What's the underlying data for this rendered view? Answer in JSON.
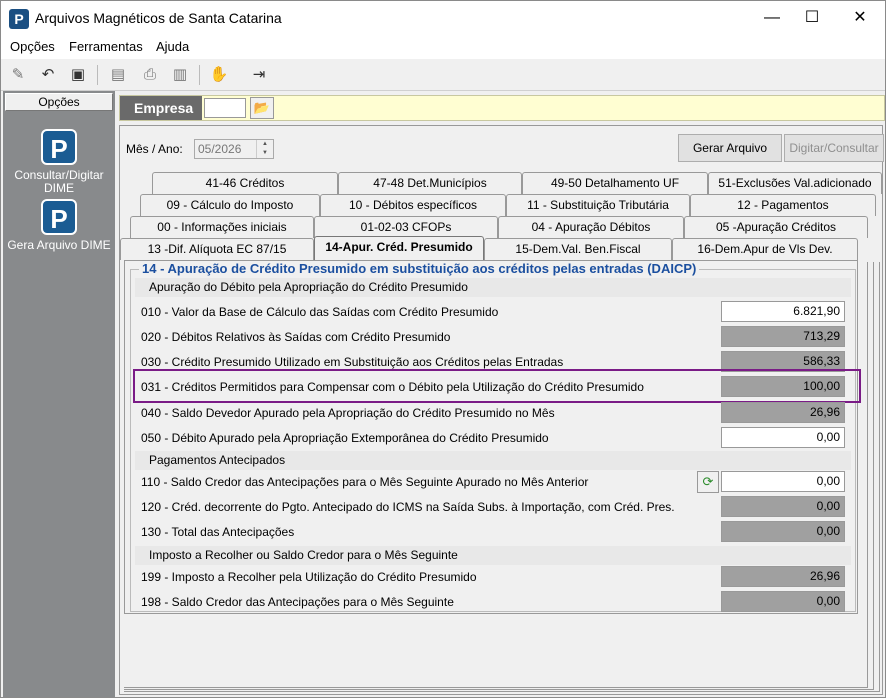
{
  "window": {
    "title": "Arquivos Magnéticos de Santa Catarina",
    "logo_letter": "P",
    "minimize": "—",
    "maximize": "☐",
    "close": "✕"
  },
  "menu": [
    "Opções",
    "Ferramentas",
    "Ajuda"
  ],
  "sidebar": {
    "header": "Opções",
    "items": [
      {
        "label": "Consultar/Digitar DIME",
        "icon": "P"
      },
      {
        "label": "Gera Arquivo DIME",
        "icon": "P"
      }
    ]
  },
  "empresa": {
    "label": "Empresa",
    "value": ""
  },
  "period": {
    "label": "Mês / Ano:",
    "value": "05/2026"
  },
  "buttons": {
    "gerar": "Gerar Arquivo",
    "digitar": "Digitar/Consultar"
  },
  "tabs": {
    "row1": [
      "41-46   Créditos",
      "47-48  Det.Municípios",
      "49-50   Detalhamento UF",
      "51-Exclusões Val.adicionado"
    ],
    "row2": [
      "09 - Cálculo do Imposto",
      "10 - Débitos específicos",
      "11 - Substituição Tributária",
      "12 - Pagamentos"
    ],
    "row3": [
      "00 - Informações iniciais",
      "01-02-03    CFOPs",
      "04 - Apuração Débitos",
      "05 -Apuração Créditos"
    ],
    "row4": [
      "13 -Dif. Alíquota EC 87/15",
      "14-Apur. Créd. Presumido",
      "15-Dem.Val. Ben.Fiscal",
      "16-Dem.Apur de Vls Dev."
    ]
  },
  "panel": {
    "title": "14 - Apuração de Crédito Presumido em substituição aos créditos pelas entradas (DAICP)",
    "sections": [
      {
        "title": "Apuração do Débito pela Apropriação do Crédito Presumido",
        "rows": [
          {
            "label": "010 - Valor da Base de Cálculo das Saídas com Crédito Presumido",
            "value": "6.821,90",
            "editable": true
          },
          {
            "label": "020 - Débitos Relativos às Saídas com Crédito Presumido",
            "value": "713,29",
            "editable": false
          },
          {
            "label": "030 - Crédito Presumido Utilizado em Substituição aos Créditos pelas Entradas",
            "value": "586,33",
            "editable": false
          },
          {
            "label": "031 - Créditos Permitidos para Compensar com o Débito pela Utilização do Crédito Presumido",
            "value": "100,00",
            "editable": false
          },
          {
            "label": "040 - Saldo Devedor Apurado pela Apropriação do Crédito Presumido no Mês",
            "value": "26,96",
            "editable": false
          },
          {
            "label": "050 - Débito Apurado pela Apropriação Extemporânea do Crédito Presumido",
            "value": "0,00",
            "editable": true
          }
        ]
      },
      {
        "title": "Pagamentos Antecipados",
        "rows": [
          {
            "label": "110 - Saldo Credor das Antecipações para o Mês Seguinte Apurado no Mês Anterior",
            "value": "0,00",
            "editable": true
          },
          {
            "label": "120 - Créd. decorrente do Pgto. Antecipado do ICMS na Saída Subs. à Importação, com Créd. Pres.",
            "value": "0,00",
            "editable": false
          },
          {
            "label": "130 - Total das Antecipações",
            "value": "0,00",
            "editable": false
          }
        ]
      },
      {
        "title": "Imposto a Recolher ou Saldo Credor para o Mês Seguinte",
        "rows": [
          {
            "label": "199 - Imposto a Recolher pela Utilização do Crédito Presumido",
            "value": "26,96",
            "editable": false
          },
          {
            "label": "198 - Saldo Credor das Antecipações para o Mês Seguinte",
            "value": "0,00",
            "editable": false
          }
        ]
      }
    ]
  },
  "colors": {
    "highlight": "#7a1b86",
    "group_title": "#1b4f9f",
    "readonly_field": "#a0a0a0",
    "sidebar": "#888a8c"
  }
}
